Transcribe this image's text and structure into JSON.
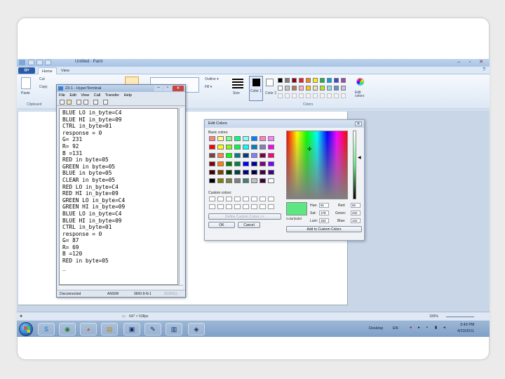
{
  "paint": {
    "title": "Untitled - Paint",
    "file_tab": "▤▾",
    "tabs": [
      "Home",
      "View"
    ],
    "clipboard": {
      "paste": "Paste",
      "cut": "Cut",
      "copy": "Copy",
      "group": "Clipboard"
    },
    "shapes": {
      "outline": "Outline ▾",
      "fill": "Fill ▾"
    },
    "size_label": "Size",
    "color1_label": "Color 1",
    "color2_label": "Color 2",
    "colors_group": "Colors",
    "edit_colors_label": "Edit colors",
    "palette": [
      "#000000",
      "#7f7f7f",
      "#880015",
      "#ed1c24",
      "#ff7f27",
      "#fff200",
      "#22b14c",
      "#00a2e8",
      "#3f48cc",
      "#a349a4",
      "#ffffff",
      "#c3c3c3",
      "#b97a57",
      "#ffaec9",
      "#ffc90e",
      "#efe4b0",
      "#b5e61d",
      "#99d9ea",
      "#7092be",
      "#c8bfe7"
    ],
    "status": {
      "dimensions": "647 × 538px",
      "zoom": "100%"
    }
  },
  "hyperterminal": {
    "title": "23-1 - HyperTerminal",
    "menu": [
      "File",
      "Edit",
      "View",
      "Call",
      "Transfer",
      "Help"
    ],
    "lines": [
      "BLUE LO in_byte=C4",
      "BLUE HI in_byte=09",
      "CTRL in_byte=01",
      "response = 0",
      "G= 231",
      "R= 92",
      "B =131",
      "RED in byte=05",
      "GREEN in byte=05",
      "BLUE in byte=05",
      "CLEAR in byte=05",
      "RED LO in_byte=C4",
      "RED HI in_byte=09",
      "GREEN LO in_byte=C4",
      "GREEN HI in_byte=09",
      "BLUE LO in_byte=C4",
      "BLUE HI in_byte=09",
      "CTRL in_byte=01",
      "response = 0",
      "G= 87",
      "R= 69",
      "B =120",
      "RED in byte=05",
      "_"
    ],
    "status": {
      "connection": "Disconnected",
      "terminal": "ANSIW",
      "settings": "9600 8-N-1",
      "scroll": "SCROLL"
    }
  },
  "edit_colors": {
    "title": "Edit Colors",
    "basic_label": "Basic colors:",
    "custom_label": "Custom colors:",
    "basic_colors": [
      "#ff8080",
      "#ffff80",
      "#80ff80",
      "#00ff80",
      "#80ffff",
      "#0080ff",
      "#ff80c0",
      "#ff80ff",
      "#ff0000",
      "#ffff00",
      "#80ff00",
      "#00ff40",
      "#00ffff",
      "#0080c0",
      "#8080c0",
      "#ff00ff",
      "#804040",
      "#ff8040",
      "#00ff00",
      "#008080",
      "#004080",
      "#8080ff",
      "#800040",
      "#ff0080",
      "#800000",
      "#ff8000",
      "#008000",
      "#008040",
      "#0000ff",
      "#0000a0",
      "#800080",
      "#8000ff",
      "#400000",
      "#804000",
      "#004000",
      "#004040",
      "#000080",
      "#000040",
      "#400040",
      "#400080",
      "#000000",
      "#808000",
      "#808040",
      "#808080",
      "#408080",
      "#c0c0c0",
      "#400040",
      "#ffffff"
    ],
    "define_button": "Define Custom Colors >>",
    "ok_button": "OK",
    "cancel_button": "Cancel",
    "color_solid_label": "Color|Solid",
    "hue_label": "Hue:",
    "hue": "91",
    "sat_label": "Sat:",
    "sat": "178",
    "lum_label": "Lum:",
    "lum": "152",
    "red_label": "Red:",
    "red": "92",
    "green_label": "Green:",
    "green": "231",
    "blue_label": "Blue:",
    "blue": "131",
    "add_button": "Add to Custom Colors",
    "current_color": "#5ce783"
  },
  "taskbar": {
    "desktop_label": "Desktop",
    "lang": "EN",
    "time": "3:43 PM",
    "date": "4/23/2011"
  }
}
